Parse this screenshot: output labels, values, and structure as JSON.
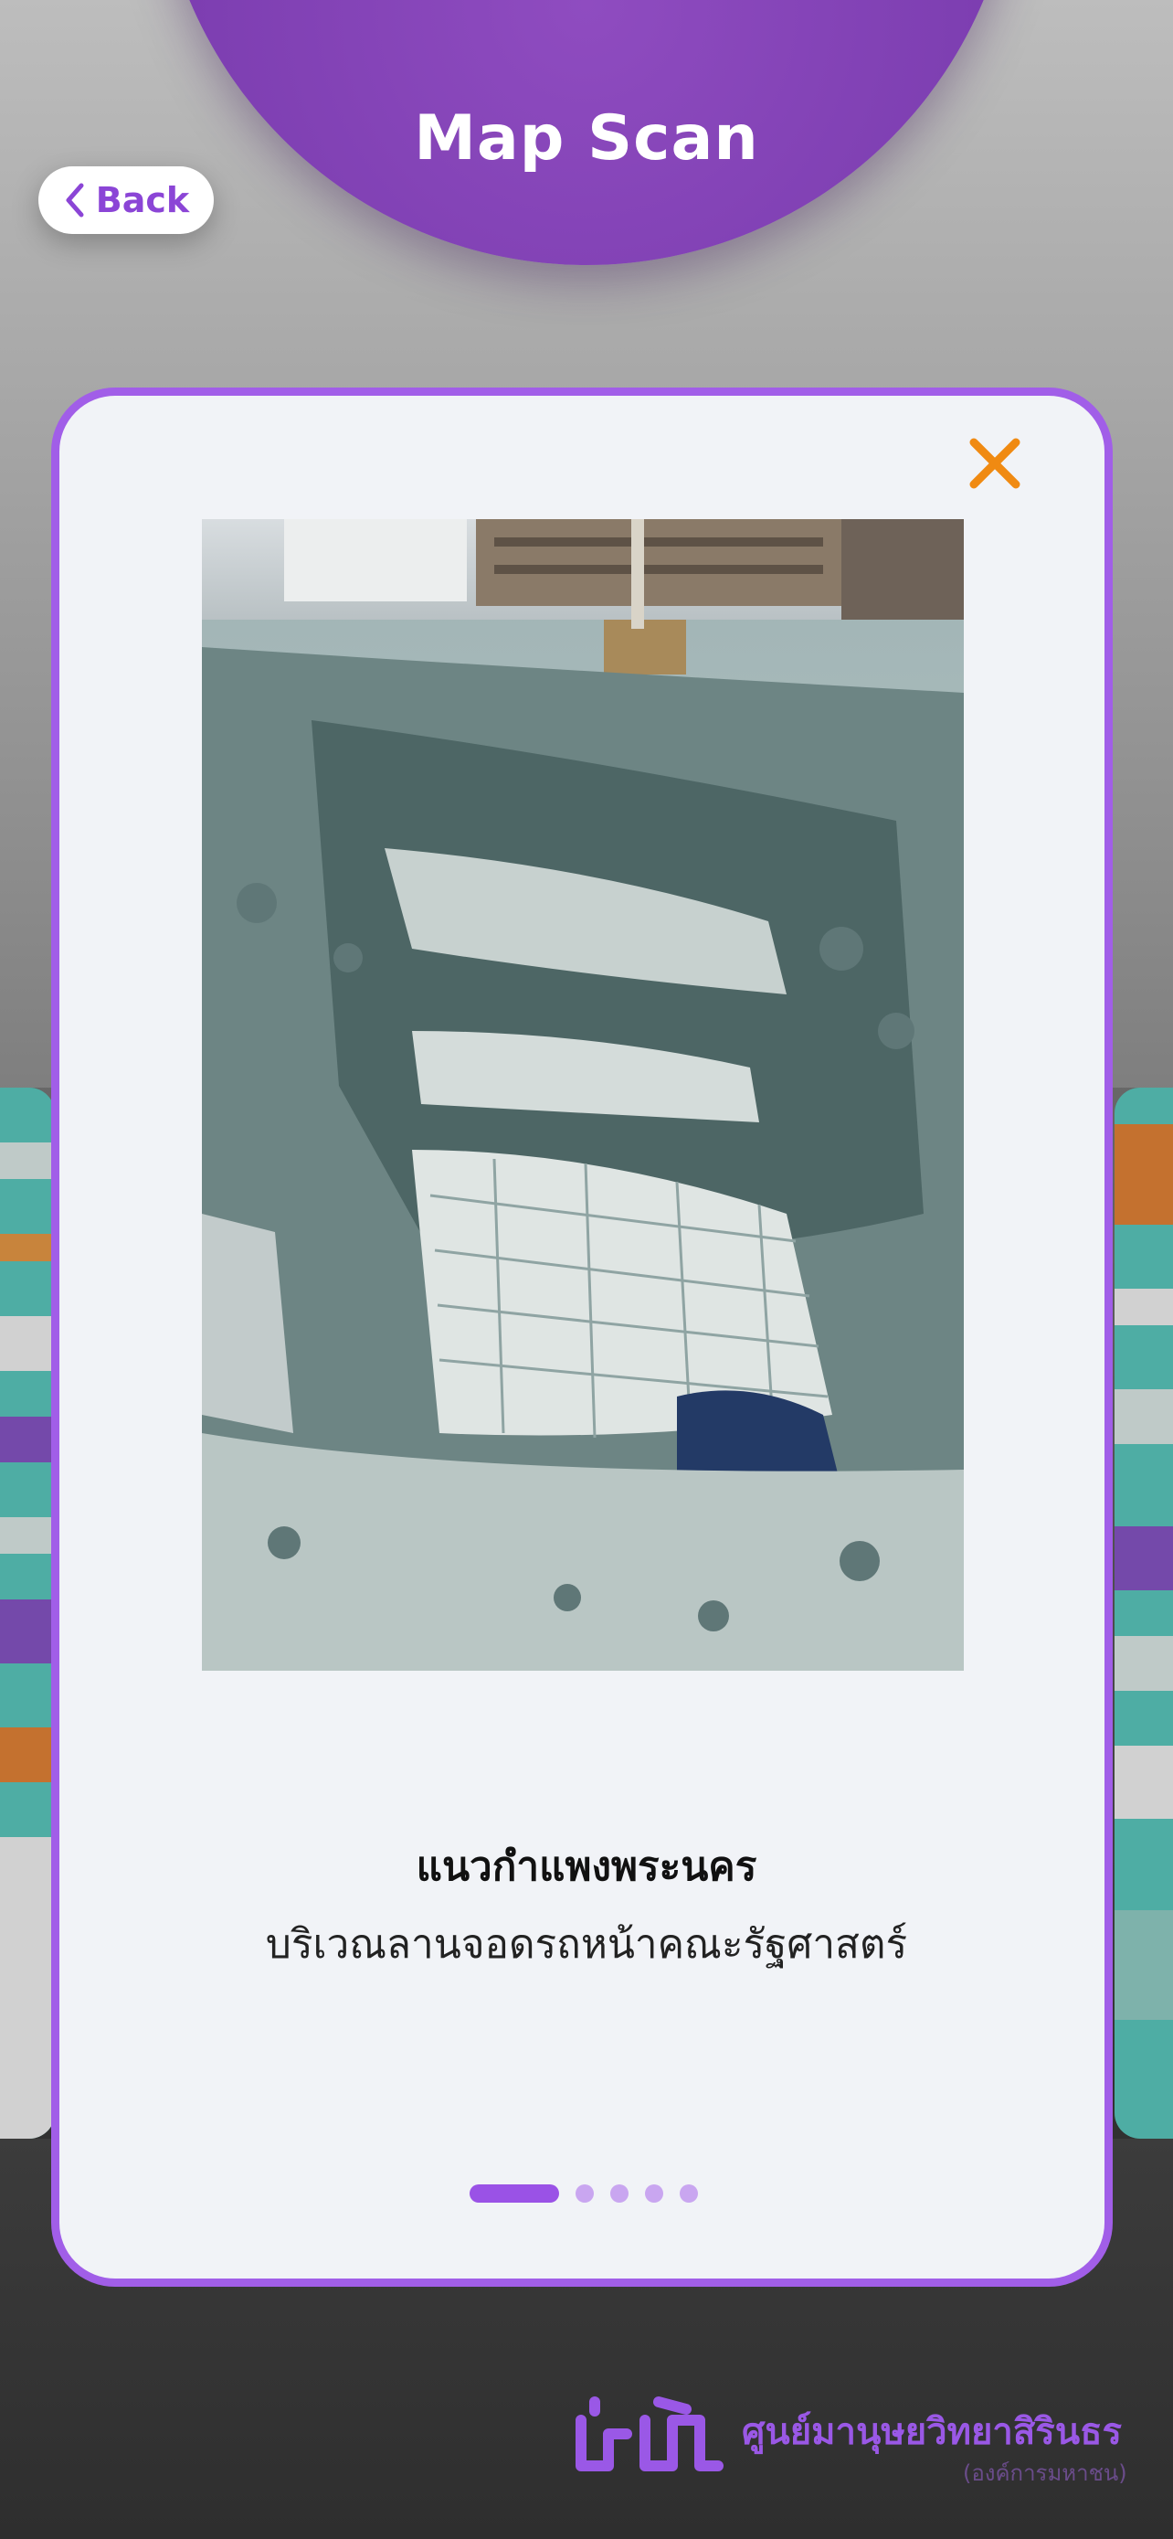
{
  "header": {
    "title": "Map Scan"
  },
  "back_button": {
    "label": "Back"
  },
  "modal": {
    "caption_title": "แนวกำแพงพระนคร",
    "caption_subtitle": "บริเวณลานจอดรถหน้าคณะรัฐศาสตร์",
    "pagination": {
      "total": 5,
      "current": 1
    }
  },
  "footer": {
    "org_name": "ศูนย์มานุษยวิทยาสิรินธร",
    "org_sub": "(องค์การมหาชน)"
  },
  "colors": {
    "accent": "#9a52e6",
    "close": "#f08a12",
    "header": "#7e3fb2"
  },
  "icons": {
    "back": "chevron-left-icon",
    "close": "close-icon"
  }
}
